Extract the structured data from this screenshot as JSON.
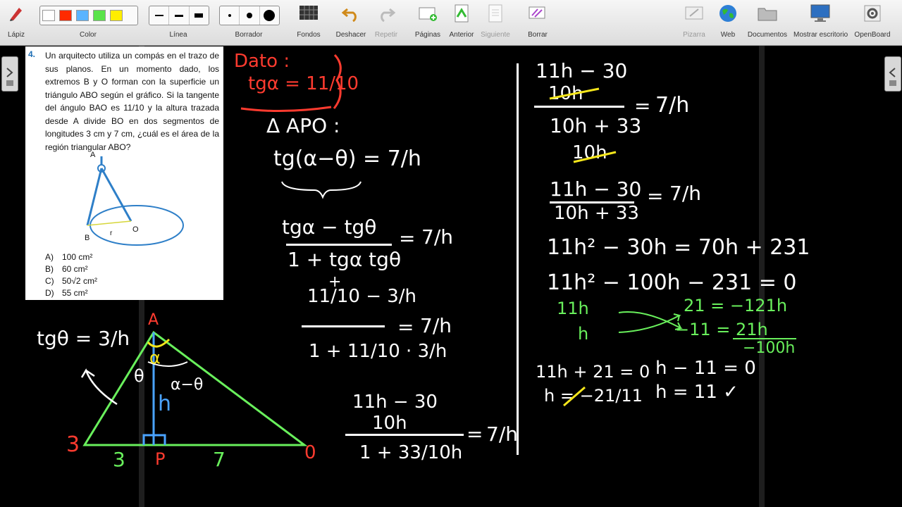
{
  "toolbar": {
    "lapiz": "Lápiz",
    "color": "Color",
    "linea": "Línea",
    "borrador": "Borrador",
    "fondos": "Fondos",
    "deshacer": "Deshacer",
    "repetir": "Repetir",
    "paginas": "Páginas",
    "anterior": "Anterior",
    "siguiente": "Siguiente",
    "borrar": "Borrar",
    "pizarra": "Pizarra",
    "web": "Web",
    "documentos": "Documentos",
    "mostrar": "Mostrar escritorio",
    "openboard": "OpenBoard",
    "colors": [
      "#ffffff",
      "#ff2a00",
      "#5ab4ff",
      "#59e34a",
      "#ffee00"
    ]
  },
  "problem": {
    "number": "4.",
    "text": "Un arquitecto utiliza un compás en el trazo de sus planos. En un momento dado, los extremos B y O forman con la superficie un triángulo ABO según el gráfico. Si la tangente del ángulo BAO es 11/10 y la altura trazada desde A divide BO en dos segmentos de longitudes 3 cm y 7 cm, ¿cuál es el área de la región triangular ABO?",
    "labels": {
      "a": "A",
      "b": "B",
      "o": "O",
      "r": "r"
    },
    "options": [
      {
        "key": "A)",
        "value": "100 cm²"
      },
      {
        "key": "B)",
        "value": "60 cm²"
      },
      {
        "key": "C)",
        "value": "50√2 cm²"
      },
      {
        "key": "D)",
        "value": "55 cm²"
      }
    ]
  },
  "board": {
    "dato_label": "Dato :",
    "dato_value": "tgα = 11/10",
    "triangle_title": "Δ APO :",
    "eq1": "tg(α−θ) = 7/h",
    "eq2_num": "tgα − tgθ",
    "eq2_den": "1 + tgα tgθ",
    "seven_over_h": "7/h",
    "eq3_num": "11/10 − 3/h",
    "eq3_den": "1 + 11/10 · 3/h",
    "eq4_num": "11h − 30",
    "eq4_num_den": "10h",
    "eq4_den": "1 + 33/10h",
    "tg_theta": "tgθ = 3/h",
    "tri_labels": {
      "a": "A",
      "b": "3",
      "o": "0",
      "p": "P",
      "h": "h",
      "seg_left": "3",
      "seg_right": "7",
      "alpha": "α",
      "theta": "θ",
      "alpha_minus_theta": "α−θ"
    },
    "r1_num": "11h − 30",
    "r1_num_den": "10h",
    "r1_den": "10h + 33",
    "r1_den_den": "10h",
    "r2_num": "11h − 30",
    "r2_den": "10h + 33",
    "r3": "11h² − 30h = 70h + 231",
    "r4": "11h² − 100h − 231 = 0",
    "f_left_top": "11h",
    "f_left_bot": "h",
    "f_right_top": "21 = −121h",
    "f_right_bot": "−11 = 21h",
    "f_sum": "−100h",
    "sol1": "11h + 21 = 0",
    "sol1b": "h = −21/11",
    "sol2": "h − 11 = 0",
    "sol2b": "h = 11 ✓"
  }
}
